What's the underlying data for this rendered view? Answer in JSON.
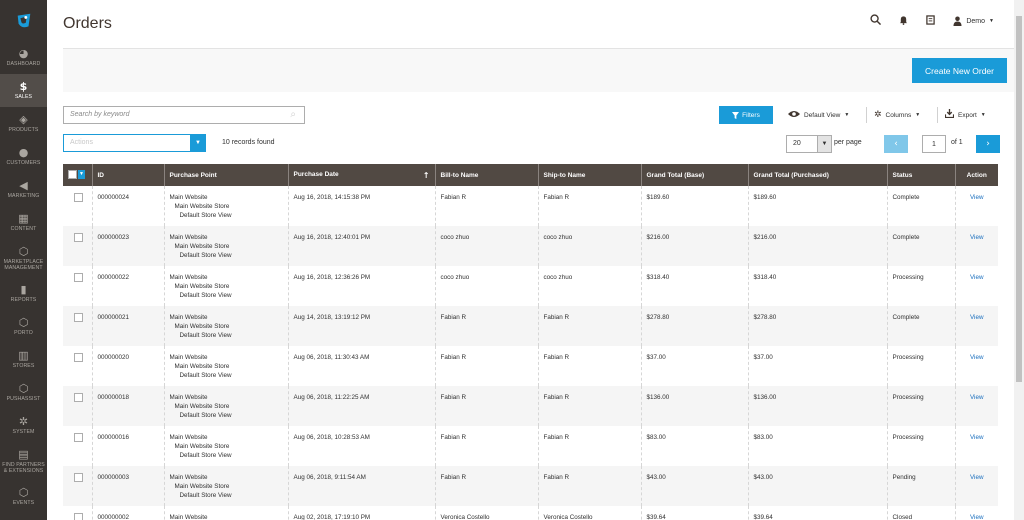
{
  "sidebar": {
    "logo": "magento-logo",
    "items": [
      {
        "label": "DASHBOARD",
        "icon": "dashboard-icon",
        "glyph": "◕"
      },
      {
        "label": "SALES",
        "icon": "dollar-icon",
        "glyph": "$"
      },
      {
        "label": "PRODUCTS",
        "icon": "cube-icon",
        "glyph": "◈"
      },
      {
        "label": "CUSTOMERS",
        "icon": "customers-icon",
        "glyph": "●"
      },
      {
        "label": "MARKETING",
        "icon": "megaphone-icon",
        "glyph": "◀"
      },
      {
        "label": "CONTENT",
        "icon": "content-icon",
        "glyph": "▦"
      },
      {
        "label": "MARKETPLACE MANAGEMENT",
        "icon": "hexagon-icon",
        "glyph": "⬡"
      },
      {
        "label": "REPORTS",
        "icon": "bar-chart-icon",
        "glyph": "▮"
      },
      {
        "label": "PORTO",
        "icon": "hexagon-icon",
        "glyph": "⬡"
      },
      {
        "label": "STORES",
        "icon": "store-icon",
        "glyph": "▥"
      },
      {
        "label": "PUSHASSIST",
        "icon": "hexagon-icon",
        "glyph": "⬡"
      },
      {
        "label": "SYSTEM",
        "icon": "gear-icon",
        "glyph": "✲"
      },
      {
        "label": "FIND PARTNERS & EXTENSIONS",
        "icon": "blocks-icon",
        "glyph": "▤"
      },
      {
        "label": "EVENTS",
        "icon": "hexagon-icon",
        "glyph": "⬡"
      }
    ]
  },
  "header": {
    "title": "Orders",
    "user": "Demo",
    "icons": [
      "search-icon",
      "bell-icon",
      "notebook-icon",
      "user-icon"
    ]
  },
  "action_bar": {
    "create_label": "Create New Order"
  },
  "toolbar": {
    "search_placeholder": "Search by keyword",
    "filters_label": "Filters",
    "view_label": "Default View",
    "columns_label": "Columns",
    "export_label": "Export",
    "actions_label": "Actions",
    "records_found": "10 records found",
    "per_page_value": "20",
    "per_page_label": "per page",
    "page_value": "1",
    "page_total": "of 1"
  },
  "table": {
    "columns": [
      "ID",
      "Purchase Point",
      "Purchase Date",
      "Bill-to Name",
      "Ship-to Name",
      "Grand Total (Base)",
      "Grand Total (Purchased)",
      "Status",
      "Action"
    ],
    "purchase_point": [
      "Main Website",
      "Main Website Store",
      "Default Store View"
    ],
    "view_label": "View",
    "rows": [
      {
        "id": "000000024",
        "date": "Aug 16, 2018, 14:15:38 PM",
        "bill": "Fabian R",
        "ship": "Fabian R",
        "base": "$189.60",
        "purchased": "$189.60",
        "status": "Complete"
      },
      {
        "id": "000000023",
        "date": "Aug 16, 2018, 12:40:01 PM",
        "bill": "coco zhuo",
        "ship": "coco zhuo",
        "base": "$216.00",
        "purchased": "$216.00",
        "status": "Complete"
      },
      {
        "id": "000000022",
        "date": "Aug 16, 2018, 12:36:26 PM",
        "bill": "coco zhuo",
        "ship": "coco zhuo",
        "base": "$318.40",
        "purchased": "$318.40",
        "status": "Processing"
      },
      {
        "id": "000000021",
        "date": "Aug 14, 2018, 13:19:12 PM",
        "bill": "Fabian R",
        "ship": "Fabian R",
        "base": "$278.80",
        "purchased": "$278.80",
        "status": "Complete"
      },
      {
        "id": "000000020",
        "date": "Aug 06, 2018, 11:30:43 AM",
        "bill": "Fabian R",
        "ship": "Fabian R",
        "base": "$37.00",
        "purchased": "$37.00",
        "status": "Processing"
      },
      {
        "id": "000000018",
        "date": "Aug 06, 2018, 11:22:25 AM",
        "bill": "Fabian R",
        "ship": "Fabian R",
        "base": "$136.00",
        "purchased": "$136.00",
        "status": "Processing"
      },
      {
        "id": "000000016",
        "date": "Aug 06, 2018, 10:28:53 AM",
        "bill": "Fabian R",
        "ship": "Fabian R",
        "base": "$83.00",
        "purchased": "$83.00",
        "status": "Processing"
      },
      {
        "id": "000000003",
        "date": "Aug 06, 2018, 9:11:54 AM",
        "bill": "Fabian R",
        "ship": "Fabian R",
        "base": "$43.00",
        "purchased": "$43.00",
        "status": "Pending"
      },
      {
        "id": "000000002",
        "date": "Aug 02, 2018, 17:19:10 PM",
        "bill": "Veronica Costello",
        "ship": "Veronica Costello",
        "base": "$39.64",
        "purchased": "$39.64",
        "status": "Closed"
      }
    ]
  },
  "colors": {
    "sidebar_bg": "#373330",
    "header_bg": "#514943",
    "accent": "#1a9bd8",
    "link": "#1a6fbf"
  }
}
